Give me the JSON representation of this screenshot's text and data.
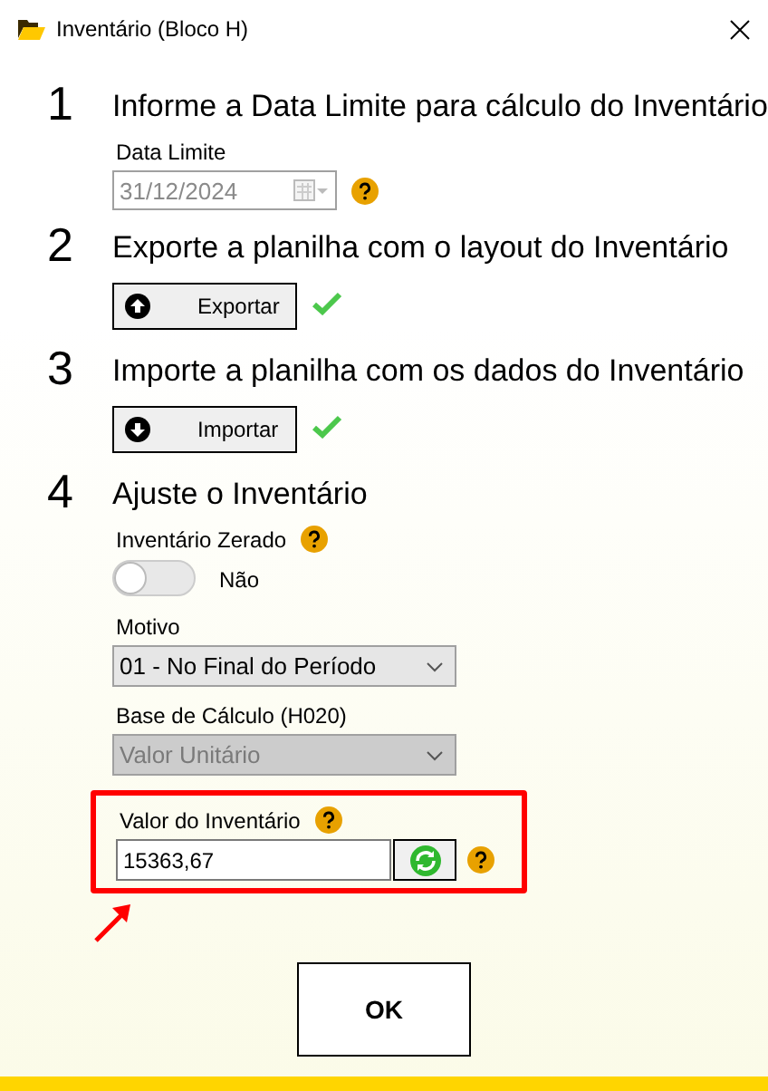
{
  "window": {
    "title": "Inventário (Bloco H)"
  },
  "steps": [
    {
      "number": "1",
      "heading": "Informe a Data Limite para cálculo do Inventário",
      "kind": "date",
      "label": "Data Limite",
      "value": "31/12/2024",
      "disabled": true
    },
    {
      "number": "2",
      "heading": "Exporte a planilha com o layout do Inventário",
      "kind": "action",
      "button": {
        "label": "Exportar",
        "kind": "upload"
      },
      "done": true
    },
    {
      "number": "3",
      "heading": "Importe a planilha com os dados do Inventário",
      "kind": "action",
      "button": {
        "label": "Importar",
        "kind": "download"
      },
      "done": true
    },
    {
      "number": "4",
      "heading": "Ajuste o Inventário",
      "kind": "adjust"
    }
  ],
  "adjust": {
    "zero_label": "Inventário Zerado",
    "zero_toggle": {
      "on": false,
      "text": "Não"
    },
    "reason": {
      "label": "Motivo",
      "value": "01 - No Final do Período",
      "disabled": false
    },
    "base": {
      "label": "Base de Cálculo (H020)",
      "value": "Valor Unitário",
      "disabled": true
    },
    "amount": {
      "label": "Valor do Inventário",
      "value": "15363,67",
      "highlighted": true
    }
  },
  "ok_button": "OK"
}
